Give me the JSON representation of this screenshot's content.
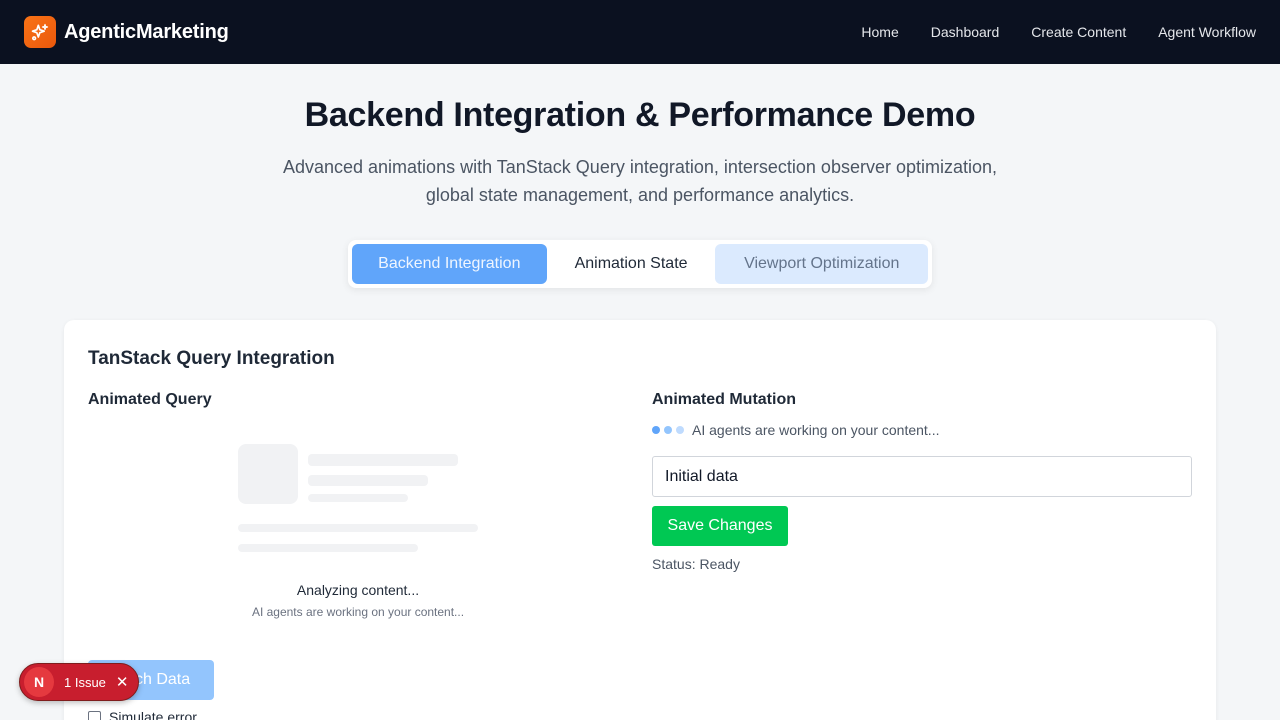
{
  "header": {
    "brand": "AgenticMarketing",
    "logo_icon": "sparkles-icon",
    "nav": [
      "Home",
      "Dashboard",
      "Create Content",
      "Agent Workflow"
    ]
  },
  "hero": {
    "title": "Backend Integration & Performance Demo",
    "subtitle": "Advanced animations with TanStack Query integration, intersection observer optimization, global state management, and performance analytics."
  },
  "tabs": [
    "Backend Integration",
    "Animation State",
    "Viewport Optimization"
  ],
  "card": {
    "title": "TanStack Query Integration",
    "query": {
      "title": "Animated Query",
      "loading_title": "Analyzing content...",
      "loading_sub": "AI agents are working on your content...",
      "fetch_label": "Fetch Data",
      "checkbox_label": "Simulate error"
    },
    "mutation": {
      "title": "Animated Mutation",
      "working_msg": "AI agents are working on your content...",
      "input_value": "Initial data",
      "save_label": "Save Changes",
      "status": "Status: Ready"
    }
  },
  "issue_badge": {
    "letter": "N",
    "label": "1 Issue",
    "close": "✕"
  },
  "colors": {
    "header_bg": "#0b1120",
    "brand_accent": "#f97316",
    "tab_active": "#60a5fa",
    "save_green": "#00c853",
    "issue_red": "#c81e2e"
  }
}
